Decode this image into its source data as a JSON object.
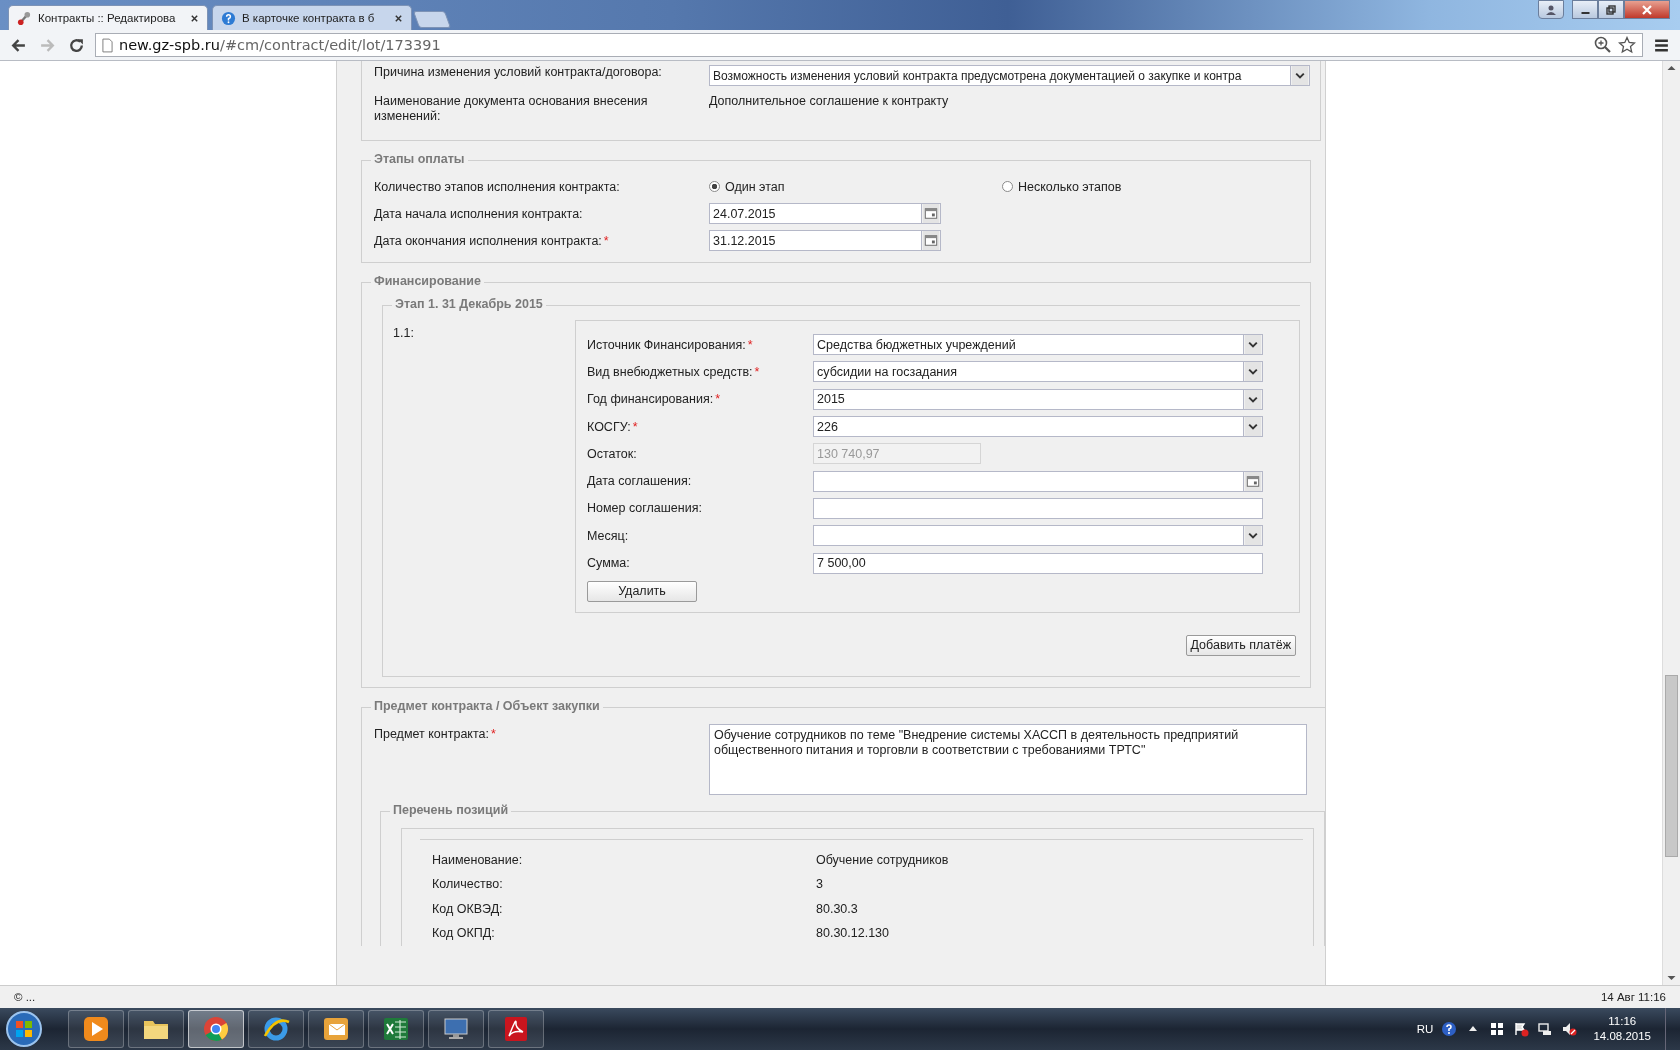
{
  "browser": {
    "tabs": [
      {
        "title": "Контракты :: Редактирова",
        "selected": true
      },
      {
        "title": "В карточке контракта в б",
        "selected": false
      }
    ],
    "url_host": "new.gz-spb.ru",
    "url_path": "/#cm/contract/edit/lot/173391"
  },
  "changes": {
    "rows": [
      {
        "label": "Причина изменения условий контракта/договора:",
        "kind": "select",
        "value": "Возможность изменения условий контракта предусмотрена документацией о закупке и контра"
      },
      {
        "label": "Наименование документа основания внесения изменений:",
        "kind": "text",
        "value": "Дополнительное соглашение к контракту"
      }
    ]
  },
  "payment_stages": {
    "legend": "Этапы оплаты",
    "count_label": "Количество этапов исполнения контракта:",
    "options": [
      {
        "label": "Один этап",
        "selected": true
      },
      {
        "label": "Несколько этапов",
        "selected": false
      }
    ],
    "rows": [
      {
        "label": "Дата начала исполнения контракта:",
        "value": "24.07.2015"
      },
      {
        "label": "Дата окончания исполнения контракта:",
        "required_mark": "*",
        "value": "31.12.2015"
      }
    ]
  },
  "financing": {
    "legend": "Финансирование",
    "stage_legend": "Этап 1. 31 Декабрь 2015",
    "item_label": "1.1:",
    "fields": [
      {
        "label": "Источник Финансирования:",
        "required_mark": "*",
        "kind": "select",
        "disabled": false,
        "value": "Средства бюджетных учреждений"
      },
      {
        "label": "Вид внебюджетных средств:",
        "required_mark": "*",
        "kind": "select",
        "disabled": false,
        "value": "субсидии на госзадания"
      },
      {
        "label": "Год финансирования:",
        "required_mark": "*",
        "kind": "select",
        "disabled": false,
        "value": "2015"
      },
      {
        "label": "КОСГУ:",
        "required_mark": "*",
        "kind": "select",
        "disabled": false,
        "value": "226"
      },
      {
        "label": "Остаток:",
        "kind": "short",
        "disabled": true,
        "value": "130 740,97"
      },
      {
        "label": "Дата соглашения:",
        "kind": "date",
        "disabled": false
      },
      {
        "label": "Номер соглашения:",
        "kind": "text",
        "disabled": false
      },
      {
        "label": "Месяц:",
        "kind": "select",
        "disabled": false
      },
      {
        "label": "Сумма:",
        "kind": "text",
        "disabled": false,
        "value": "7 500,00"
      }
    ],
    "delete_button": "Удалить",
    "add_button": "Добавить платёж"
  },
  "subject": {
    "legend": "Предмет контракта / Объект закупки",
    "label": "Предмет контракта:",
    "required_mark": "*",
    "value": "Обучение сотрудников по теме \"Внедрение системы ХАССП в деятельность предприятий общественного питания и торговли в соответствии с требованиями ТРТС\""
  },
  "positions": {
    "legend": "Перечень позиций",
    "rows": [
      {
        "label": "Наименование:",
        "value": "Обучение сотрудников"
      },
      {
        "label": "Количество:",
        "value": "3"
      },
      {
        "label": "Код ОКВЭД:",
        "value": "80.30.3"
      },
      {
        "label": "Код ОКПД:",
        "value": "80.30.12.130"
      }
    ]
  },
  "status_bar": {
    "left": "© ...",
    "right": "14 Авг 11:16"
  },
  "taskbar": {
    "apps": [
      {
        "kind": "media",
        "selected": false
      },
      {
        "kind": "folder",
        "selected": false
      },
      {
        "kind": "chrome",
        "selected": true
      },
      {
        "kind": "ie",
        "selected": false
      },
      {
        "kind": "outlook",
        "selected": false
      },
      {
        "kind": "excel",
        "selected": false
      },
      {
        "kind": "remote",
        "selected": false
      },
      {
        "kind": "acrobat",
        "selected": false
      }
    ],
    "language": "RU",
    "time": "11:16",
    "date": "14.08.2015"
  }
}
